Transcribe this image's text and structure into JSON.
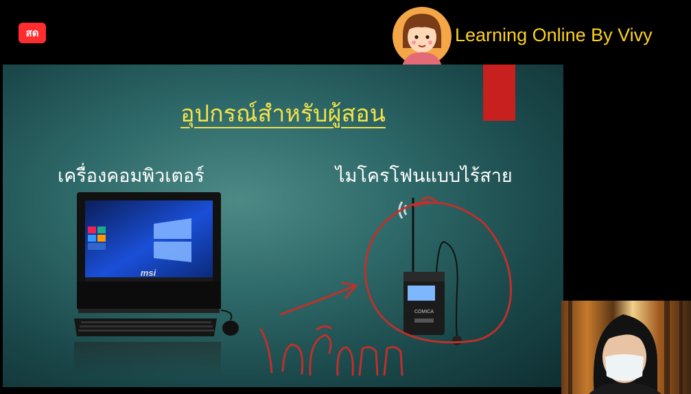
{
  "badge": {
    "live_label": "สด"
  },
  "channel": {
    "name": "Learning Online By Vivy"
  },
  "slide": {
    "title": "อุปกรณ์สำหรับผู้สอน",
    "left_label": "เครื่องคอมพิวเตอร์",
    "right_label": "ไมโครโฟนแบบไร้สาย",
    "monitor_brand": "msi",
    "mic_brand": "COMICA"
  },
  "icons": {
    "live_badge": "live-badge",
    "avatar": "cartoon-girl-avatar",
    "wireless": "wireless-signal-icon"
  },
  "colors": {
    "title": "#f3e34a",
    "accent": "#c81f1f",
    "annotation": "#c0302a",
    "live": "#ff2d2d",
    "channel": "#ffd21f"
  }
}
